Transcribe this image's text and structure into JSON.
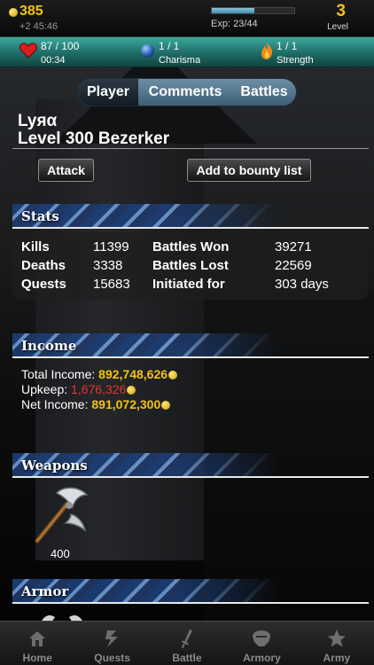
{
  "header": {
    "gold": "385",
    "gold_timer": "+2 45:46",
    "exp_text": "Exp: 23/44",
    "exp_fraction": 0.52,
    "level": "3",
    "level_label": "Level"
  },
  "status": {
    "health": "87 / 100",
    "health_timer": "00:34",
    "charisma": "1 / 1",
    "charisma_label": "Charisma",
    "strength": "1 / 1",
    "strength_label": "Strength"
  },
  "tabs": [
    {
      "label": "Player",
      "active": true
    },
    {
      "label": "Comments",
      "active": false
    },
    {
      "label": "Battles",
      "active": false
    }
  ],
  "profile": {
    "name": "Lyяα",
    "title": "Level 300 Bezerker",
    "attack_label": "Attack",
    "bounty_label": "Add to bounty list"
  },
  "stats": {
    "heading": "Stats",
    "kills_label": "Kills",
    "kills": "11399",
    "deaths_label": "Deaths",
    "deaths": "3338",
    "quests_label": "Quests",
    "quests": "15683",
    "won_label": "Battles Won",
    "won": "39271",
    "lost_label": "Battles Lost",
    "lost": "22569",
    "initiated_label": "Initiated for",
    "initiated": "303 days"
  },
  "income": {
    "heading": "Income",
    "total_label": "Total Income: ",
    "total": "892,748,626",
    "upkeep_label": "Upkeep: ",
    "upkeep": "1,676,326",
    "net_label": "Net Income: ",
    "net": "891,072,300"
  },
  "weapons": {
    "heading": "Weapons",
    "items": [
      {
        "icon": "battle-axe-icon",
        "count": "400"
      }
    ]
  },
  "armor": {
    "heading": "Armor"
  },
  "nav": [
    {
      "label": "Home",
      "icon": "home-icon"
    },
    {
      "label": "Quests",
      "icon": "quests-icon"
    },
    {
      "label": "Battle",
      "icon": "sword-icon"
    },
    {
      "label": "Armory",
      "icon": "helmet-icon"
    },
    {
      "label": "Army",
      "icon": "star-icon"
    }
  ],
  "colors": {
    "gold": "#f1c40f",
    "upkeep_red": "#e53535",
    "status_teal": "#1f6c66",
    "section_blue": "#1d3f78"
  }
}
